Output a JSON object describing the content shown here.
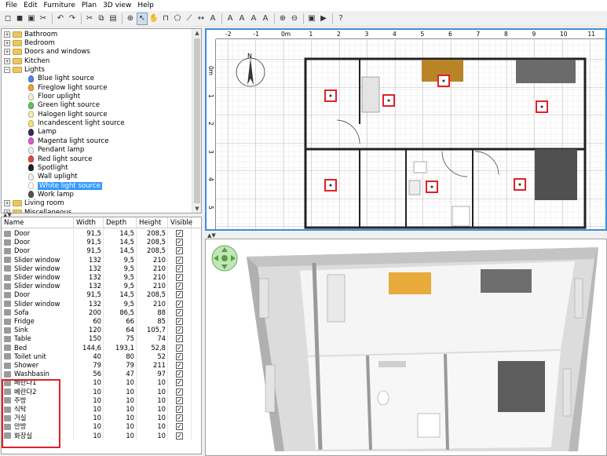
{
  "menu": [
    "File",
    "Edit",
    "Furniture",
    "Plan",
    "3D view",
    "Help"
  ],
  "toolbar_icons": [
    "new-home-icon",
    "open-icon",
    "save-icon",
    "cut-tool-icon",
    "undo-icon",
    "redo-icon",
    "cut-icon",
    "copy-icon",
    "paste-icon",
    "add-furniture-icon",
    "select-icon",
    "pan-icon",
    "create-walls-icon",
    "create-rooms-icon",
    "create-polylines-icon",
    "create-dimensions-icon",
    "create-labels-icon",
    "increase-text-icon",
    "decrease-text-icon",
    "bold-icon",
    "italic-icon",
    "zoom-in-icon",
    "zoom-out-icon",
    "create-photo-icon",
    "create-video-icon",
    "help-icon"
  ],
  "toolbar_glyphs": [
    "◻",
    "◼",
    "▣",
    "✂",
    "↶",
    "↷",
    "✂",
    "⧉",
    "▤",
    "⊕",
    "↖",
    "✋",
    "⊓",
    "⬠",
    "⟋",
    "↔",
    "A",
    "A",
    "A",
    "A",
    "A",
    "⊕",
    "⊖",
    "▣",
    "▶",
    "?"
  ],
  "catalog": {
    "categories": [
      {
        "label": "Bathroom",
        "expanded": false
      },
      {
        "label": "Bedroom",
        "expanded": false
      },
      {
        "label": "Doors and windows",
        "expanded": false
      },
      {
        "label": "Kitchen",
        "expanded": false
      },
      {
        "label": "Lights",
        "expanded": true
      },
      {
        "label": "Living room",
        "expanded": false
      },
      {
        "label": "Miscellaneous",
        "expanded": false
      }
    ],
    "lights": [
      {
        "label": "Blue light source",
        "color": "#4f86e8"
      },
      {
        "label": "Fireglow light source",
        "color": "#f2a23b"
      },
      {
        "label": "Floor uplight",
        "color": "#f4efd2"
      },
      {
        "label": "Green light source",
        "color": "#63c25b"
      },
      {
        "label": "Halogen light source",
        "color": "#f3efb0"
      },
      {
        "label": "Incandescent light source",
        "color": "#f7e27a"
      },
      {
        "label": "Lamp",
        "color": "#3a2b55"
      },
      {
        "label": "Magenta light source",
        "color": "#d75fd1"
      },
      {
        "label": "Pendant lamp",
        "color": "#eeeeee"
      },
      {
        "label": "Red light source",
        "color": "#e2483f"
      },
      {
        "label": "Spotlight",
        "color": "#222222"
      },
      {
        "label": "Wall uplight",
        "color": "#f4f1e0"
      },
      {
        "label": "White light source",
        "color": "#ffffff"
      },
      {
        "label": "Work lamp",
        "color": "#555555"
      }
    ],
    "selected": "White light source"
  },
  "table": {
    "headers": [
      "Name",
      "Width",
      "Depth",
      "Height",
      "Visible"
    ],
    "rows": [
      [
        "Door",
        "91,5",
        "14,5",
        "208,5"
      ],
      [
        "Door",
        "91,5",
        "14,5",
        "208,5"
      ],
      [
        "Door",
        "91,5",
        "14,5",
        "208,5"
      ],
      [
        "Slider window",
        "132",
        "9,5",
        "210"
      ],
      [
        "Slider window",
        "132",
        "9,5",
        "210"
      ],
      [
        "Slider window",
        "132",
        "9,5",
        "210"
      ],
      [
        "Slider window",
        "132",
        "9,5",
        "210"
      ],
      [
        "Door",
        "91,5",
        "14,5",
        "208,5"
      ],
      [
        "Slider window",
        "132",
        "9,5",
        "210"
      ],
      [
        "Sofa",
        "200",
        "86,5",
        "88"
      ],
      [
        "Fridge",
        "60",
        "66",
        "85"
      ],
      [
        "Sink",
        "120",
        "64",
        "105,7"
      ],
      [
        "Table",
        "150",
        "75",
        "74"
      ],
      [
        "Bed",
        "144,6",
        "193,1",
        "52,8"
      ],
      [
        "Toilet unit",
        "40",
        "80",
        "52"
      ],
      [
        "Shower",
        "79",
        "79",
        "211"
      ],
      [
        "Washbasin",
        "56",
        "47",
        "97"
      ],
      [
        "베란다1",
        "10",
        "10",
        "10"
      ],
      [
        "베란다2",
        "10",
        "10",
        "10"
      ],
      [
        "주방",
        "10",
        "10",
        "10"
      ],
      [
        "식탁",
        "10",
        "10",
        "10"
      ],
      [
        "거실",
        "10",
        "10",
        "10"
      ],
      [
        "안방",
        "10",
        "10",
        "10"
      ],
      [
        "화장실",
        "10",
        "10",
        "10"
      ]
    ]
  },
  "plan": {
    "ruler_x": [
      "-2",
      "-1",
      "0m",
      "1",
      "2",
      "3",
      "4",
      "5",
      "6",
      "7",
      "8",
      "9",
      "10",
      "11"
    ],
    "ruler_y": [
      "0m",
      "1",
      "2",
      "3",
      "4",
      "5"
    ],
    "compass_label": "N",
    "light_count": 7
  }
}
